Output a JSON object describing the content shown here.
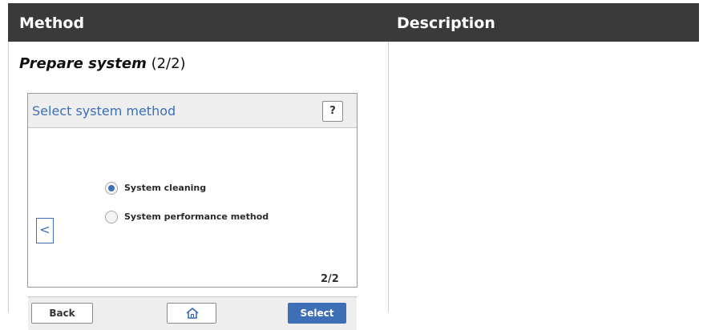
{
  "table": {
    "headers": {
      "method": "Method",
      "description": "Description"
    },
    "step": {
      "title_bold": "Prepare system",
      "title_suffix": " (2/2)"
    }
  },
  "screen": {
    "title": "Select system method",
    "help_label": "?",
    "options": [
      {
        "label": "System cleaning",
        "selected": true
      },
      {
        "label": "System performance method",
        "selected": false
      }
    ],
    "prev_label": "<",
    "page_indicator": "2/2",
    "buttons": {
      "back": "Back",
      "select": "Select"
    },
    "icons": {
      "home": "home-icon",
      "prev": "chevron-left-icon",
      "help": "question-icon"
    },
    "colors": {
      "accent": "#3d6fb6",
      "header": "#3a3a3a"
    }
  }
}
